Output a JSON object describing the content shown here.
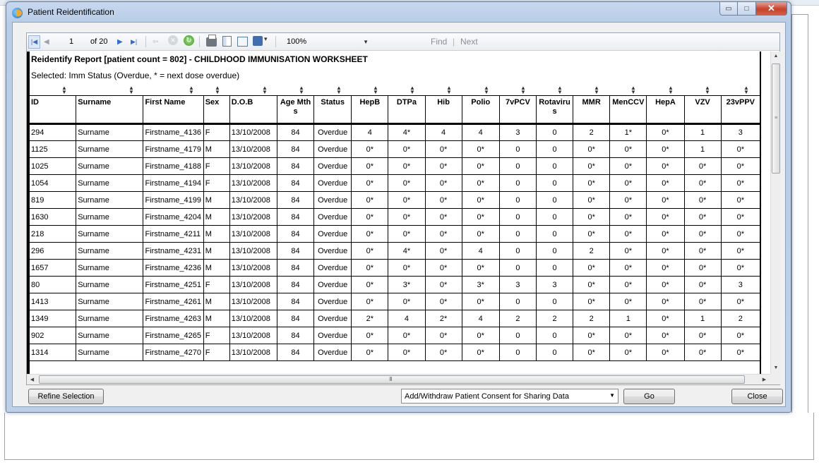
{
  "window": {
    "title": "Patient Reidentification",
    "minimize_glyph": "▭",
    "maximize_glyph": "□",
    "close_glyph": "✕"
  },
  "toolbar": {
    "page_current": "1",
    "page_of": "of 20",
    "zoom": "100%",
    "find_label": "Find",
    "separator": "|",
    "next_label": "Next",
    "icons": [
      "first-page-icon",
      "previous-page-icon",
      "next-page-icon",
      "last-page-icon",
      "back-icon",
      "stop-icon",
      "refresh-icon",
      "print-icon",
      "print-layout-icon",
      "page-setup-icon",
      "export-icon"
    ]
  },
  "report": {
    "title": "Reidentify Report  [patient count = 802] - CHILDHOOD IMMUNISATION WORKSHEET",
    "subtitle": "Selected: Imm Status (Overdue, * = next dose overdue)",
    "columns": [
      "ID",
      "Surname",
      "First Name",
      "Sex",
      "D.O.B",
      "Age Mths",
      "Status",
      "HepB",
      "DTPa",
      "Hib",
      "Polio",
      "7vPCV",
      "Rotavirus",
      "MMR",
      "MenCCV",
      "HepA",
      "VZV",
      "23vPPV"
    ],
    "rows": [
      [
        "294",
        "Surname",
        "Firstname_4136",
        "F",
        "13/10/2008",
        "84",
        "Overdue",
        "4",
        "4*",
        "4",
        "4",
        "3",
        "0",
        "2",
        "1*",
        "0*",
        "1",
        "3"
      ],
      [
        "1125",
        "Surname",
        "Firstname_4179",
        "M",
        "13/10/2008",
        "84",
        "Overdue",
        "0*",
        "0*",
        "0*",
        "0*",
        "0",
        "0",
        "0*",
        "0*",
        "0*",
        "1",
        "0*"
      ],
      [
        "1025",
        "Surname",
        "Firstname_4188",
        "F",
        "13/10/2008",
        "84",
        "Overdue",
        "0*",
        "0*",
        "0*",
        "0*",
        "0",
        "0",
        "0*",
        "0*",
        "0*",
        "0*",
        "0*"
      ],
      [
        "1054",
        "Surname",
        "Firstname_4194",
        "F",
        "13/10/2008",
        "84",
        "Overdue",
        "0*",
        "0*",
        "0*",
        "0*",
        "0",
        "0",
        "0*",
        "0*",
        "0*",
        "0*",
        "0*"
      ],
      [
        "819",
        "Surname",
        "Firstname_4199",
        "M",
        "13/10/2008",
        "84",
        "Overdue",
        "0*",
        "0*",
        "0*",
        "0*",
        "0",
        "0",
        "0*",
        "0*",
        "0*",
        "0*",
        "0*"
      ],
      [
        "1630",
        "Surname",
        "Firstname_4204",
        "M",
        "13/10/2008",
        "84",
        "Overdue",
        "0*",
        "0*",
        "0*",
        "0*",
        "0",
        "0",
        "0*",
        "0*",
        "0*",
        "0*",
        "0*"
      ],
      [
        "218",
        "Surname",
        "Firstname_4211",
        "M",
        "13/10/2008",
        "84",
        "Overdue",
        "0*",
        "0*",
        "0*",
        "0*",
        "0",
        "0",
        "0*",
        "0*",
        "0*",
        "0*",
        "0*"
      ],
      [
        "296",
        "Surname",
        "Firstname_4231",
        "M",
        "13/10/2008",
        "84",
        "Overdue",
        "0*",
        "4*",
        "0*",
        "4",
        "0",
        "0",
        "2",
        "0*",
        "0*",
        "0*",
        "0*"
      ],
      [
        "1657",
        "Surname",
        "Firstname_4236",
        "M",
        "13/10/2008",
        "84",
        "Overdue",
        "0*",
        "0*",
        "0*",
        "0*",
        "0",
        "0",
        "0*",
        "0*",
        "0*",
        "0*",
        "0*"
      ],
      [
        "80",
        "Surname",
        "Firstname_4251",
        "F",
        "13/10/2008",
        "84",
        "Overdue",
        "0*",
        "3*",
        "0*",
        "3*",
        "3",
        "3",
        "0*",
        "0*",
        "0*",
        "0*",
        "3"
      ],
      [
        "1413",
        "Surname",
        "Firstname_4261",
        "M",
        "13/10/2008",
        "84",
        "Overdue",
        "0*",
        "0*",
        "0*",
        "0*",
        "0",
        "0",
        "0*",
        "0*",
        "0*",
        "0*",
        "0*"
      ],
      [
        "1349",
        "Surname",
        "Firstname_4263",
        "M",
        "13/10/2008",
        "84",
        "Overdue",
        "2*",
        "4",
        "2*",
        "4",
        "2",
        "2",
        "2",
        "1",
        "0*",
        "1",
        "2"
      ],
      [
        "902",
        "Surname",
        "Firstname_4265",
        "F",
        "13/10/2008",
        "84",
        "Overdue",
        "0*",
        "0*",
        "0*",
        "0*",
        "0",
        "0",
        "0*",
        "0*",
        "0*",
        "0*",
        "0*"
      ],
      [
        "1314",
        "Surname",
        "Firstname_4270",
        "F",
        "13/10/2008",
        "84",
        "Overdue",
        "0*",
        "0*",
        "0*",
        "0*",
        "0",
        "0",
        "0*",
        "0*",
        "0*",
        "0*",
        "0*"
      ]
    ]
  },
  "footer": {
    "refine_label": "Refine Selection",
    "action_select": "Add/Withdraw Patient Consent for Sharing Data",
    "go_label": "Go",
    "close_label": "Close"
  },
  "scrollbar": {
    "grip_glyph": "III"
  }
}
